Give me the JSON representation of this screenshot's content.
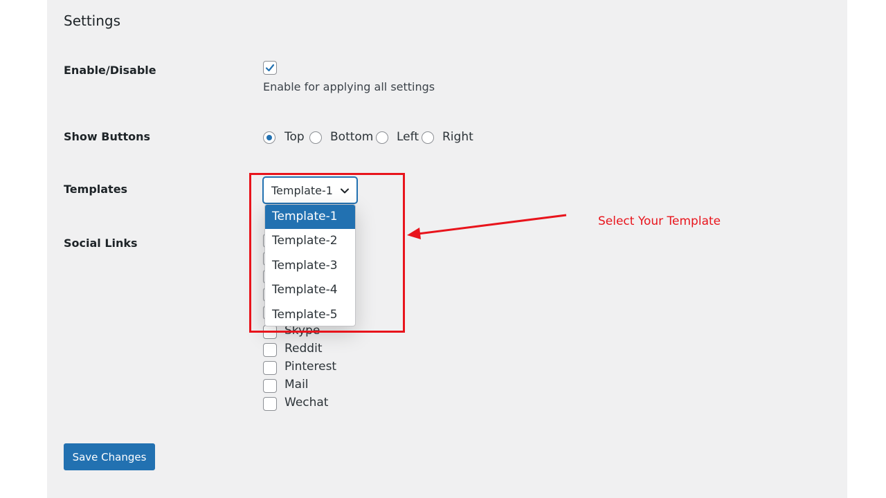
{
  "settings": {
    "title": "Settings"
  },
  "enable_disable": {
    "label": "Enable/Disable",
    "checked": true,
    "help": "Enable for applying all settings"
  },
  "show_buttons": {
    "label": "Show Buttons",
    "options": [
      "Top",
      "Bottom",
      "Left",
      "Right"
    ],
    "selected": "Top"
  },
  "templates": {
    "label": "Templates",
    "selected": "Template-1",
    "options": [
      "Template-1",
      "Template-2",
      "Template-3",
      "Template-4",
      "Template-5"
    ]
  },
  "social_links": {
    "label": "Social Links",
    "visible_items": [
      "Skype",
      "Reddit",
      "Pinterest",
      "Mail",
      "Wechat"
    ]
  },
  "actions": {
    "save_label": "Save Changes"
  },
  "annotation": {
    "text": "Select Your Template",
    "color": "#e8141c"
  },
  "colors": {
    "accent": "#2271b1",
    "panel_bg": "#f0f0f1",
    "annotation_red": "#e8141c"
  },
  "icons": {
    "checkbox_check": "check-icon",
    "select_chevron": "chevron-down-icon"
  }
}
